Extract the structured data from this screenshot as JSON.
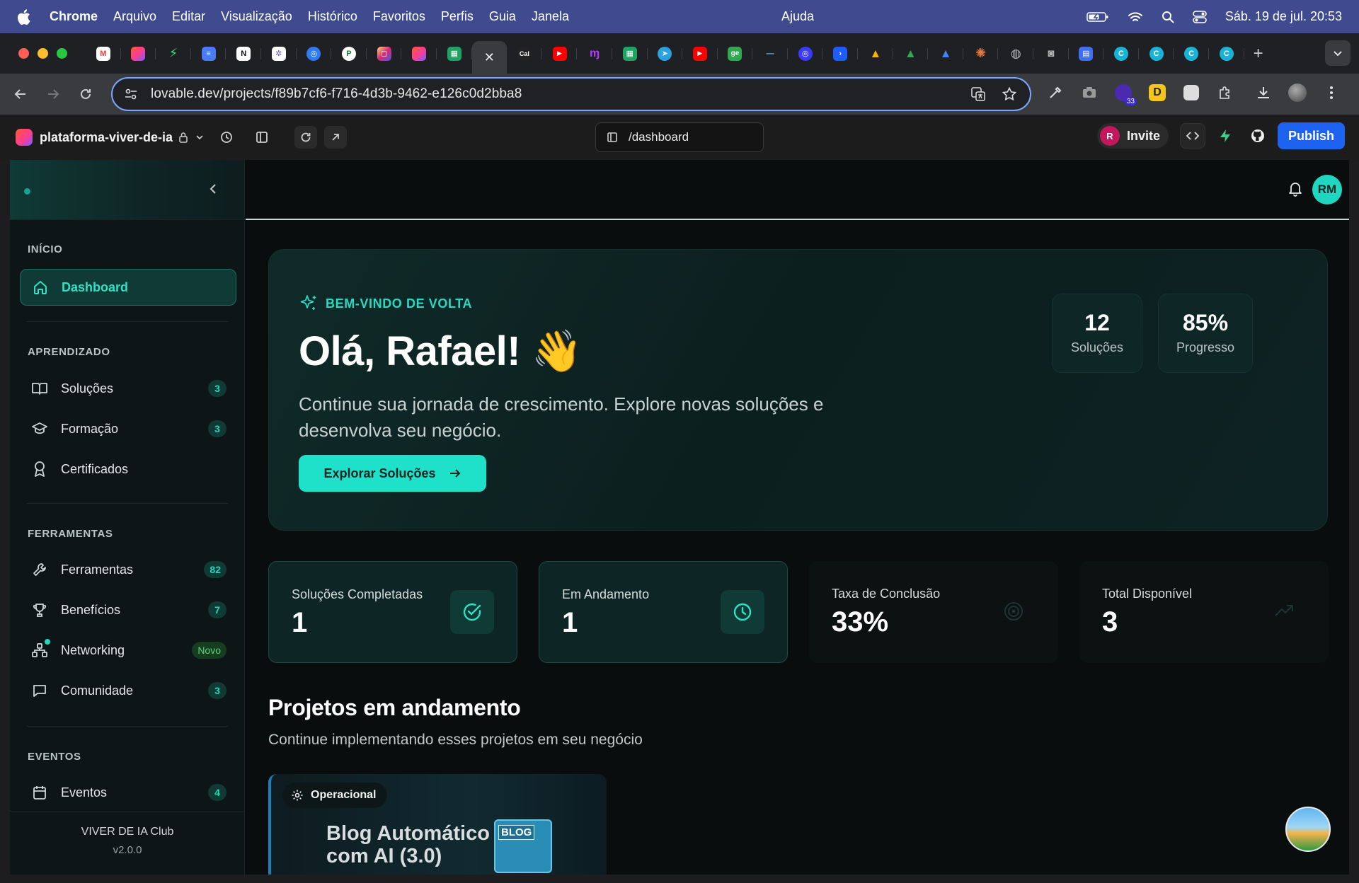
{
  "menubar": {
    "app": "Chrome",
    "items": [
      "Arquivo",
      "Editar",
      "Visualização",
      "Histórico",
      "Favoritos",
      "Perfis",
      "Guia",
      "Janela"
    ],
    "help": "Ajuda",
    "datetime": "Sáb. 19 de jul.  20:53"
  },
  "browser": {
    "url": "lovable.dev/projects/f89b7cf6-f716-4d3b-9462-e126c0d2bba8",
    "tab_favicons": [
      "gmail-icon",
      "lovable-icon",
      "bolt-icon",
      "docs-icon",
      "notion-icon",
      "perplexity-icon",
      "openai-icon",
      "producthunt-icon",
      "instagram-icon",
      "lovable-icon",
      "sheets-icon",
      "close-icon",
      "cal-icon",
      "youtube-icon",
      "make-icon",
      "sheets-icon",
      "telegram-icon",
      "youtube-icon",
      "ge-icon",
      "dash-icon",
      "openai-icon",
      "arrow-icon",
      "drive-icon",
      "drive-icon",
      "drive-icon",
      "claude-icon",
      "globe-icon",
      "camera-icon",
      "form-icon",
      "canva-icon",
      "canva-icon",
      "canva-icon",
      "canva-icon"
    ],
    "active_tab_index": 11,
    "cal_label": "Cal",
    "ge_label": "ge",
    "ext_badge": "33",
    "ext_letter": "D"
  },
  "lovable": {
    "project": "plataforma-viver-de-ia",
    "path": "/dashboard",
    "invite_initial": "R",
    "invite": "Invite",
    "publish": "Publish"
  },
  "sidebar": {
    "sections": [
      {
        "title": "INÍCIO"
      },
      {
        "title": "APRENDIZADO"
      },
      {
        "title": "FERRAMENTAS"
      },
      {
        "title": "EVENTOS"
      }
    ],
    "items": [
      {
        "label": "Dashboard",
        "badge": ""
      },
      {
        "label": "Soluções",
        "badge": "3"
      },
      {
        "label": "Formação",
        "badge": "3"
      },
      {
        "label": "Certificados",
        "badge": ""
      },
      {
        "label": "Ferramentas",
        "badge": "82"
      },
      {
        "label": "Benefícios",
        "badge": "7"
      },
      {
        "label": "Networking",
        "badge": "Novo"
      },
      {
        "label": "Comunidade",
        "badge": "3"
      },
      {
        "label": "Eventos",
        "badge": "4"
      }
    ],
    "footer_title": "VIVER DE IA Club",
    "footer_version": "v2.0.0"
  },
  "header": {
    "user_initials": "RM"
  },
  "hero": {
    "kicker": "BEM-VINDO DE VOLTA",
    "greeting": "Olá, Rafael! 👋",
    "subtitle": "Continue sua jornada de crescimento. Explore novas soluções e desenvolva seu negócio.",
    "cta": "Explorar Soluções",
    "stats": [
      {
        "value": "12",
        "label": "Soluções"
      },
      {
        "value": "85%",
        "label": "Progresso"
      }
    ]
  },
  "stats": [
    {
      "label": "Soluções Completadas",
      "value": "1",
      "icon": "check-circle-icon"
    },
    {
      "label": "Em Andamento",
      "value": "1",
      "icon": "clock-icon"
    },
    {
      "label": "Taxa de Conclusão",
      "value": "33%",
      "icon": "target-icon"
    },
    {
      "label": "Total Disponível",
      "value": "3",
      "icon": "trending-up-icon"
    }
  ],
  "projects": {
    "title": "Projetos em andamento",
    "subtitle": "Continue implementando esses projetos em seu negócio",
    "cards": [
      {
        "tag": "Operacional",
        "title_line1": "Blog Automático",
        "title_line2": "com AI (3.0)",
        "image_text": "BLOG"
      }
    ]
  },
  "colors": {
    "accent": "#1fe0c8",
    "publish": "#1e63f0",
    "menubar": "#3f4a8f"
  }
}
